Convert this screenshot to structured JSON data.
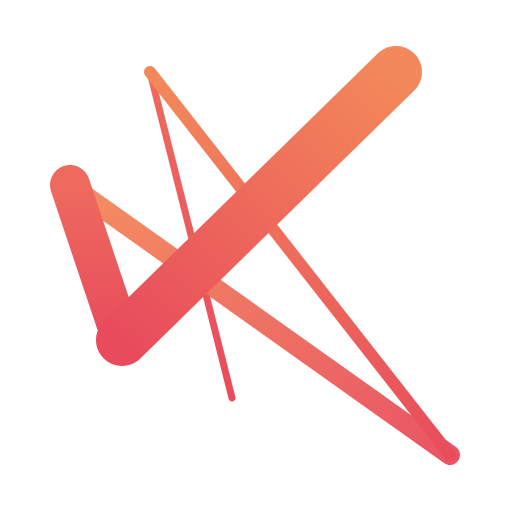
{
  "logo": {
    "name": "abstract-star-logo",
    "colors": {
      "orange": "#F3895A",
      "coral": "#EE6A5E",
      "rose": "#E84C5C"
    }
  }
}
